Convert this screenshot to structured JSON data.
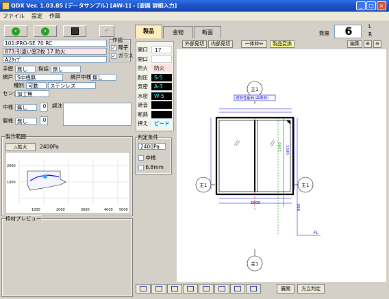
{
  "window": {
    "title": "QDX Ver. 1.03.85 [データサンプル] [AW-1] - [姿図 詳細入力]"
  },
  "menu": [
    "ファイル",
    "設定",
    "作図"
  ],
  "toolbar": {
    "left_icon": "arrow-left-icon",
    "right_icon": "arrow-right-icon",
    "save_icon": "floppy-disk-icon",
    "undo_icon": "undo-icon"
  },
  "product": {
    "line1": "101:PRO-SE 70 RC",
    "line2": "873:引違い窓2枚 17 防火",
    "line3": "A2ﾀｲﾌﾟ"
  },
  "drawing_opts": {
    "title": "作図",
    "opt1": "障子",
    "opt2": "ガラス",
    "opt1_checked": true,
    "opt2_checked": true
  },
  "fields": {
    "handle_label": "手摺",
    "handle_value": "無し",
    "handle2_label": "指詰",
    "handle2_value": "無し",
    "sash_label": "網戸",
    "sash_value": "S中桟無",
    "screen_mid_label": "網戸中桟",
    "screen_mid_value": "無し",
    "type_label": "種別",
    "type_value": "可動",
    "material_value": "ステンレス",
    "center_label": "センター",
    "center_value": "加工無",
    "mullion_label": "中桟",
    "mullion_value": "無し",
    "mullion_count": "0",
    "note_label": "誤注",
    "vert_label": "竪桟",
    "vert_value": "無し",
    "vert_count": "0"
  },
  "range": {
    "title": "製作範囲",
    "expand_label": "△拡大",
    "pressure": "2400Pa",
    "xticks": [
      "1000",
      "2000",
      "3000",
      "4000",
      "5000"
    ],
    "yticks": [
      "2000",
      "1000"
    ]
  },
  "preview": {
    "title": "枠材プレビュー"
  },
  "tabs": [
    "製品",
    "金物",
    "断面"
  ],
  "quantity": {
    "label": "数量",
    "value": "6",
    "side_l": "L",
    "side_r": "R"
  },
  "actions": {
    "outer_view": "外部見切",
    "inner_view": "内部見切",
    "one_piece": "一体枠⇔",
    "product_change": "製品変換",
    "edit": "編集"
  },
  "props": [
    {
      "label": "開口",
      "value": "17",
      "style": "white"
    },
    {
      "label": "開口",
      "value": "",
      "style": "white"
    },
    {
      "label": "防火",
      "value": "防火",
      "style": "pink"
    },
    {
      "label": "耐圧",
      "value": "S-5",
      "style": "black"
    },
    {
      "label": "気密",
      "value": "A-3",
      "style": "black"
    },
    {
      "label": "水密",
      "value": "W-5",
      "style": "black"
    },
    {
      "label": "遮音",
      "value": "",
      "style": "black"
    },
    {
      "label": "断熱",
      "value": "",
      "style": "black"
    },
    {
      "label": "押え",
      "value": "ビード",
      "style": "cyan"
    }
  ],
  "judge": {
    "title": "判定条件",
    "pressure": "2400Pa",
    "mid": "中桟",
    "glass": "6.8mm"
  },
  "drawing": {
    "grade_note": "遮熱性能有(高断熱)",
    "dims": {
      "width": "1500",
      "height": "1500",
      "total_h": "800",
      "inner_h": "1500",
      "floor": "FL"
    },
    "axis_labels": [
      "主1",
      "主1",
      "主1",
      "主1"
    ]
  },
  "bottom": {
    "expand_btn": "展開",
    "judge_btn": "方立判定"
  },
  "colors": {
    "title_blue": "#1b52c7",
    "accent_green": "#1fa51f",
    "prop_black": "#000000",
    "tab_active": "#ffeebb"
  }
}
